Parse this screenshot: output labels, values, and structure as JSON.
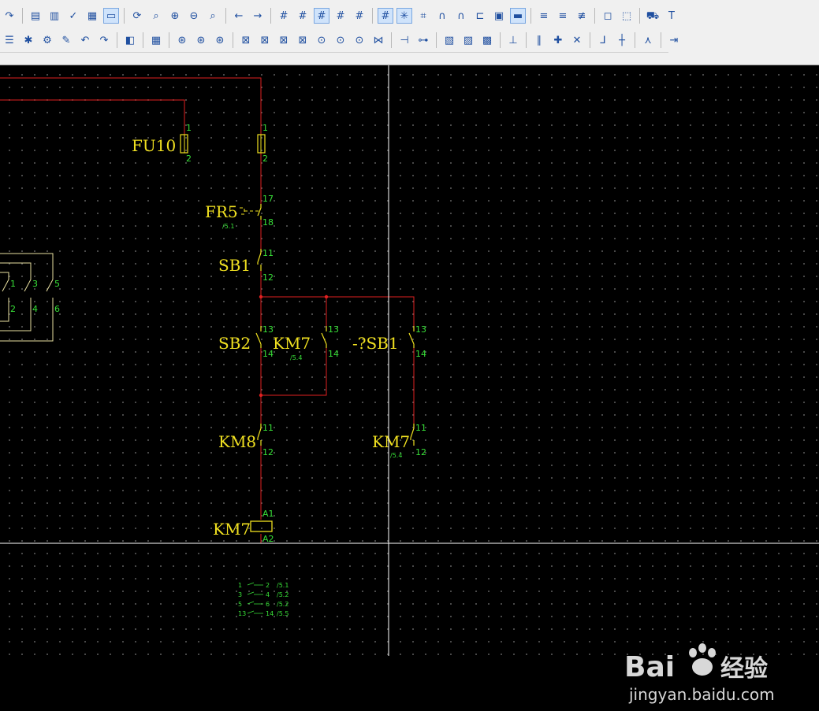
{
  "toolbar": {
    "row1": [
      {
        "name": "redo-icon",
        "glyph": "↷",
        "active": false
      },
      {
        "sep": true
      },
      {
        "name": "layout-window-icon",
        "glyph": "▤",
        "active": false
      },
      {
        "name": "window-split-icon",
        "glyph": "▥",
        "active": false
      },
      {
        "name": "page-check-icon",
        "glyph": "✓",
        "active": false
      },
      {
        "name": "grid-table-icon",
        "glyph": "▦",
        "active": false
      },
      {
        "name": "monitor-icon",
        "glyph": "▭",
        "active": true
      },
      {
        "sep": true
      },
      {
        "name": "refresh-icon",
        "glyph": "⟳",
        "active": false
      },
      {
        "name": "zoom-window-icon",
        "glyph": "⌕",
        "active": false
      },
      {
        "name": "zoom-in-icon",
        "glyph": "⊕",
        "active": false
      },
      {
        "name": "zoom-out-icon",
        "glyph": "⊖",
        "active": false
      },
      {
        "name": "zoom-100-icon",
        "glyph": "⌕",
        "active": false
      },
      {
        "sep": true
      },
      {
        "name": "arrow-back-icon",
        "glyph": "←",
        "active": false
      },
      {
        "name": "arrow-forward-icon",
        "glyph": "→",
        "active": false
      },
      {
        "sep": true
      },
      {
        "name": "grid-a-icon",
        "glyph": "#",
        "active": false
      },
      {
        "name": "grid-b-icon",
        "glyph": "#",
        "active": false
      },
      {
        "name": "grid-c-icon",
        "glyph": "#",
        "active": true
      },
      {
        "name": "grid-d-icon",
        "glyph": "#",
        "active": false
      },
      {
        "name": "grid-e-icon",
        "glyph": "#",
        "active": false
      },
      {
        "sep": true
      },
      {
        "name": "grid-snap-icon",
        "glyph": "#",
        "active": true
      },
      {
        "name": "grid-snap-point-icon",
        "glyph": "✳",
        "active": true
      },
      {
        "name": "grid-hash-icon",
        "glyph": "⌗",
        "active": false
      },
      {
        "name": "magnet-icon",
        "glyph": "∩",
        "active": false
      },
      {
        "name": "magnet-alt-icon",
        "glyph": "∩",
        "active": false
      },
      {
        "name": "connector-icon",
        "glyph": "⊏",
        "active": false
      },
      {
        "name": "label-box-icon",
        "glyph": "▣",
        "active": false
      },
      {
        "name": "ruler-icon",
        "glyph": "▬",
        "active": true
      },
      {
        "sep": true
      },
      {
        "name": "wire-lines-icon",
        "glyph": "≡",
        "active": false
      },
      {
        "name": "wire-lines-alt-icon",
        "glyph": "≡",
        "active": false
      },
      {
        "name": "wire-cross-icon",
        "glyph": "≢",
        "active": false
      },
      {
        "sep": true
      },
      {
        "name": "component-icon",
        "glyph": "◻",
        "active": false
      },
      {
        "name": "select-box-icon",
        "glyph": "⬚",
        "active": false
      },
      {
        "sep": true
      },
      {
        "name": "cart-icon",
        "glyph": "⛟",
        "active": false
      },
      {
        "name": "text-tool-icon",
        "glyph": "T",
        "active": false
      }
    ],
    "row2": [
      {
        "name": "list-icon",
        "glyph": "☰",
        "active": false
      },
      {
        "name": "new-page-icon",
        "glyph": "✱",
        "active": false
      },
      {
        "name": "page-settings-icon",
        "glyph": "⚙",
        "active": false
      },
      {
        "name": "page-edit-icon",
        "glyph": "✎",
        "active": false
      },
      {
        "name": "page-undo-icon",
        "glyph": "↶",
        "active": false
      },
      {
        "name": "page-redo-icon",
        "glyph": "↷",
        "active": false
      },
      {
        "sep": true
      },
      {
        "name": "macro-icon",
        "glyph": "◧",
        "active": false
      },
      {
        "sep": true
      },
      {
        "name": "device-list-icon",
        "glyph": "▦",
        "active": false
      },
      {
        "sep": true
      },
      {
        "name": "insert-device-icon",
        "glyph": "⊛",
        "active": false
      },
      {
        "name": "device-navigator-icon",
        "glyph": "⊛",
        "active": false
      },
      {
        "name": "device-connect-icon",
        "glyph": "⊛",
        "active": false
      },
      {
        "sep": true
      },
      {
        "name": "terminal-a-icon",
        "glyph": "⊠",
        "active": false
      },
      {
        "name": "terminal-b-icon",
        "glyph": "⊠",
        "active": false
      },
      {
        "name": "terminal-c-icon",
        "glyph": "⊠",
        "active": false
      },
      {
        "name": "terminal-d-icon",
        "glyph": "⊠",
        "active": false
      },
      {
        "name": "plc-a-icon",
        "glyph": "⊙",
        "active": false
      },
      {
        "name": "plc-b-icon",
        "glyph": "⊙",
        "active": false
      },
      {
        "name": "plc-c-icon",
        "glyph": "⊙",
        "active": false
      },
      {
        "name": "cable-icon",
        "glyph": "⋈",
        "active": false
      },
      {
        "sep": true
      },
      {
        "name": "contact-icon",
        "glyph": "⊣",
        "active": false
      },
      {
        "name": "coil-icon",
        "glyph": "⊶",
        "active": false
      },
      {
        "sep": true
      },
      {
        "name": "hatch-a-icon",
        "glyph": "▧",
        "active": false
      },
      {
        "name": "hatch-b-icon",
        "glyph": "▨",
        "active": false
      },
      {
        "name": "hatch-c-icon",
        "glyph": "▩",
        "active": false
      },
      {
        "sep": true
      },
      {
        "name": "potential-icon",
        "glyph": "⊥",
        "active": false
      },
      {
        "sep": true
      },
      {
        "name": "wire-parallel-icon",
        "glyph": "∥",
        "active": false
      },
      {
        "name": "wire-cross-point-icon",
        "glyph": "✚",
        "active": false
      },
      {
        "name": "wire-interrupt-icon",
        "glyph": "✕",
        "active": false
      },
      {
        "sep": true
      },
      {
        "name": "wire-angle-icon",
        "glyph": "⅃",
        "active": false
      },
      {
        "name": "wire-tee-icon",
        "glyph": "┼",
        "active": false
      },
      {
        "sep": true
      },
      {
        "name": "wire-branch-icon",
        "glyph": "⋏",
        "active": false
      },
      {
        "sep": true
      },
      {
        "name": "wire-jump-icon",
        "glyph": "⇥",
        "active": false
      }
    ]
  },
  "schematic": {
    "fu10": {
      "tag": "FU10",
      "pin_top": "1",
      "pin_bottom": "2"
    },
    "fu_right": {
      "pin_top": "1",
      "pin_bottom": "2"
    },
    "fr5": {
      "tag": "FR5",
      "pin_top": "17",
      "pin_bottom": "18",
      "ref": "/5.1"
    },
    "sb1": {
      "tag": "SB1",
      "pin_top": "11",
      "pin_bottom": "12"
    },
    "sb2": {
      "tag": "SB2",
      "pin_top": "13",
      "pin_bottom": "14"
    },
    "km7_aux": {
      "tag": "KM7",
      "pin_top": "13",
      "pin_bottom": "14",
      "ref": "/5.4"
    },
    "qsb1": {
      "tag": "-?SB1",
      "pin_top": "13",
      "pin_bottom": "14"
    },
    "km8": {
      "tag": "KM8",
      "pin_top": "11",
      "pin_bottom": "12"
    },
    "km7_nc": {
      "tag": "KM7",
      "pin_top": "11",
      "pin_bottom": "12",
      "ref": "/5.4"
    },
    "km7_coil": {
      "tag": "KM7",
      "pin_top": "A1",
      "pin_bottom": "A2"
    },
    "left_contacts": {
      "pins_top": [
        "1",
        "3",
        "5"
      ],
      "pins_bottom": [
        "2",
        "4",
        "6"
      ]
    },
    "contact_table": [
      {
        "a": "1",
        "b": "2",
        "ref": "/5.1"
      },
      {
        "a": "3",
        "b": "4",
        "ref": "/5.2"
      },
      {
        "a": "5",
        "b": "6",
        "ref": "/5.2"
      },
      {
        "a": "13",
        "b": "14",
        "ref": "/5.5"
      }
    ]
  },
  "colors": {
    "wire": "#e02020",
    "component": "#f0e020",
    "pin": "#38e038",
    "crosshair": "#ffffff",
    "left_wire": "#e8e0a0"
  },
  "watermark": {
    "brand_left": "Bai",
    "brand_right": "经验",
    "url": "jingyan.baidu.com"
  }
}
